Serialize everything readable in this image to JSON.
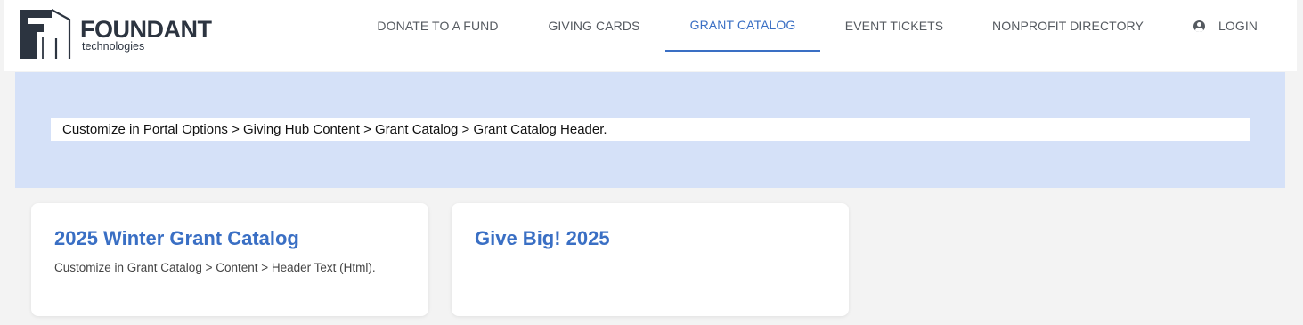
{
  "brand": {
    "name": "FOUNDANT",
    "tagline": "technologies",
    "logo_icon": "foundant-logo-icon"
  },
  "nav": {
    "items": [
      {
        "label": "DONATE TO A FUND",
        "active": false
      },
      {
        "label": "GIVING CARDS",
        "active": false
      },
      {
        "label": "GRANT CATALOG",
        "active": true
      },
      {
        "label": "EVENT TICKETS",
        "active": false
      },
      {
        "label": "NONPROFIT DIRECTORY",
        "active": false
      }
    ],
    "login": {
      "label": "LOGIN",
      "icon": "user-circle-icon"
    }
  },
  "banner": {
    "text": "Customize in Portal Options > Giving Hub Content > Grant Catalog > Grant Catalog Header."
  },
  "cards": [
    {
      "title": "2025 Winter Grant Catalog",
      "description": "Customize in Grant Catalog > Content > Header Text (Html)."
    },
    {
      "title": "Give Big! 2025",
      "description": ""
    }
  ],
  "colors": {
    "accent": "#3a6fc4",
    "banner_bg": "#d5e1f8",
    "page_bg": "#f3f3f3",
    "nav_text": "#555a60",
    "brand_text": "#2c3440"
  }
}
